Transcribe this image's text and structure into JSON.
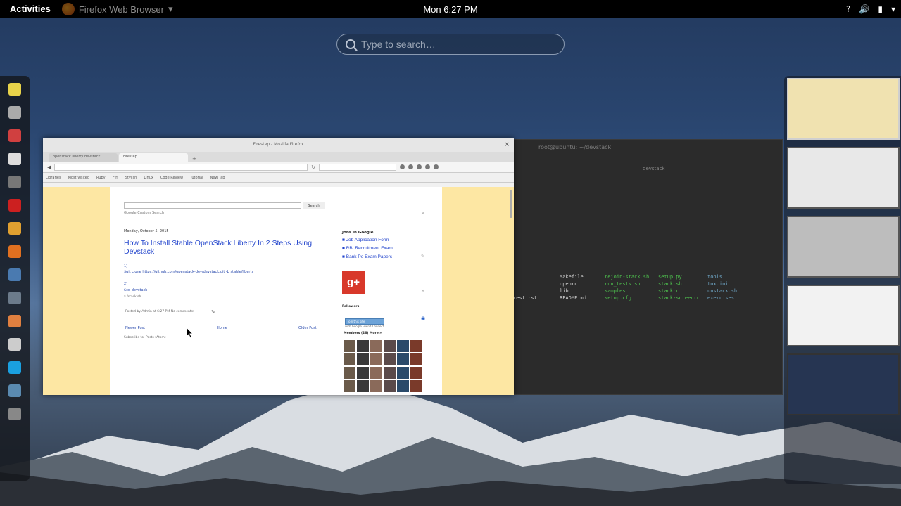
{
  "topbar": {
    "activities": "Activities",
    "app_menu": "Firefox Web Browser",
    "clock": "Mon  6:27 PM",
    "status_icons": [
      "help-icon",
      "volume-icon",
      "battery-icon",
      "power-menu-icon"
    ]
  },
  "search": {
    "placeholder": "Type to search…"
  },
  "dash": {
    "items": [
      "notes-icon",
      "files-icon",
      "software-icon",
      "text-editor-icon",
      "terminal-icon",
      "pdf-viewer-icon",
      "chrome-icon",
      "firefox-icon",
      "image-viewer-icon",
      "virtualbox-icon",
      "gimp-icon",
      "document-icon",
      "skype-icon",
      "settings-icon",
      "app-grid-icon"
    ],
    "colors": [
      "#e8d34a",
      "#aaaaaa",
      "#d04040",
      "#dddddd",
      "#777777",
      "#cc2020",
      "#e0a030",
      "#e07020",
      "#4a7ab0",
      "#6c7b8b",
      "#e08040",
      "#cccccc",
      "#1aa0e0",
      "#5a8ab0",
      "#888888"
    ]
  },
  "firefox": {
    "title": "Firestep - Mozilla Firefox",
    "tabs": [
      "openstack liberty devstack",
      "Firestep"
    ],
    "bookmarks": [
      "Libraries",
      "Most Visited",
      "Ruby",
      "Ffrl",
      "Stylish",
      "Linux",
      "Code Review",
      "Tutorial",
      "New Tab"
    ],
    "page": {
      "search_button": "Search",
      "google_label": "Google  Custom Search",
      "date": "Monday, October 5, 2015",
      "post_title": "How To Install Stable OpenStack Liberty In 2 Steps Using Devstack",
      "post_link": "$git clone https://github.com/openstack-dev/devstack.git -b stable/liberty",
      "post_extra1": "$cd devstack",
      "post_extra2": "$./stack.sh",
      "footer_meta": "Posted by Admin at 6:27 PM   No comments:",
      "footer_nav": [
        "Newer Post",
        "Home",
        "Older Post"
      ],
      "subscribe": "Subscribe to: Posts (Atom)",
      "sidebar_head": "Jobs In Google",
      "sidebar_links": [
        "Job Application Form",
        "RBI Recruitment Exam",
        "Bank Po Exam Papers"
      ],
      "gplus": "g+",
      "followers_label": "Followers",
      "follow_btn": "Join this site",
      "follow_sub": "with Google Friend Connect",
      "members_label": "Members (26)  More »"
    }
  },
  "terminal": {
    "title": "root@ubuntu: ~/devstack",
    "tab_label": "devstack",
    "lines": [
      {
        "a": "Makefile",
        "b": "rejoin-stack.sh",
        "c": "setup.py",
        "d": "tools"
      },
      {
        "a": "openrc",
        "b": "run_tests.sh",
        "c": "stack.sh",
        "d": "tox.ini"
      },
      {
        "a": "lib",
        "b": "samples",
        "c": "stackrc",
        "d": "unstack.sh"
      },
      {
        "a": "README.md",
        "b": "setup.cfg",
        "c": "stack-screenrc",
        "d": "exercises"
      }
    ],
    "prefix": [
      "",
      "",
      "",
      "rest.rst"
    ]
  }
}
